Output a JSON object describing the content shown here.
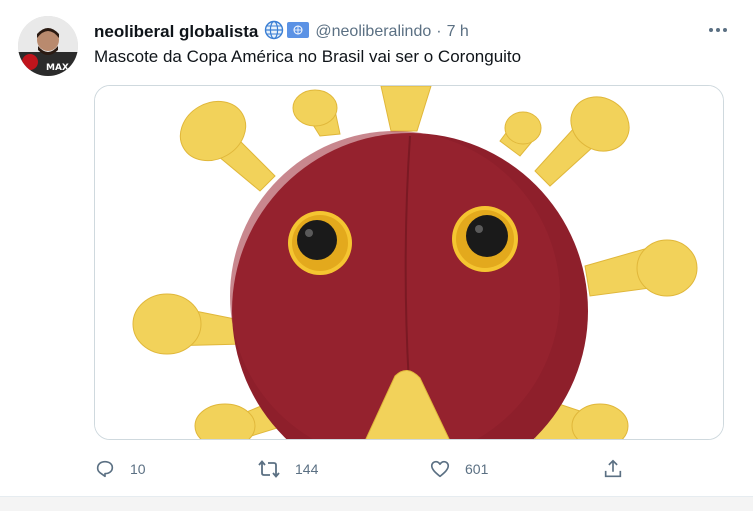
{
  "tweet": {
    "display_name": "neoliberal globalista",
    "handle": "@neoliberalindo",
    "separator": "·",
    "time": "7 h",
    "text": "Mascote da Copa América no Brasil vai ser o Coronguito",
    "avatar_text": "MAX"
  },
  "actions": {
    "replies": "10",
    "retweets": "144",
    "likes": "601"
  },
  "colors": {
    "text_primary": "#0f1419",
    "text_secondary": "#5b7083",
    "plush_body": "#8e1f2b",
    "plush_spikes": "#f2d25a"
  }
}
